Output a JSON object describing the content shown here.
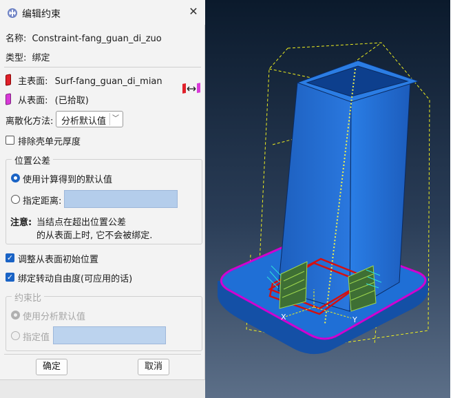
{
  "dialog": {
    "title": "编辑约束",
    "name_label": "名称:",
    "name_value": "Constraint-fang_guan_di_zuo",
    "type_label": "类型:",
    "type_value": "绑定",
    "master_label": "主表面:",
    "master_value": "Surf-fang_guan_di_mian",
    "slave_label": "从表面:",
    "slave_value": "(已拾取)",
    "discretization_label": "离散化方法:",
    "discretization_value": "分析默认值",
    "exclude_shell_label": "排除壳单元厚度",
    "exclude_shell_checked": false,
    "position_tolerance": {
      "title": "位置公差",
      "option_computed": "使用计算得到的默认值",
      "option_specify": "指定距离:",
      "specify_value": "",
      "note_label": "注意:",
      "note_line1": "当结点在超出位置公差",
      "note_line2": "的从表面上时, 它不会被绑定."
    },
    "adjust_slave_label": "调整从表面初始位置",
    "adjust_slave_checked": true,
    "tie_rotation_label": "绑定转动自由度(可应用的话)",
    "tie_rotation_checked": true,
    "constraint_ratio": {
      "title": "约束比",
      "option_default": "使用分析默认值",
      "option_specify": "指定值",
      "specify_value": ""
    },
    "ok_label": "确定",
    "cancel_label": "取消"
  },
  "viewport": {
    "triad_labels": [
      "X",
      "Y"
    ],
    "colors": {
      "background_top": "#0b1a2c",
      "background_bottom": "#5c6f88",
      "part": "#1f6fd6",
      "master_outline": "#d000d0",
      "slave_outline": "#d01010",
      "bounding_box": "#f0f020"
    }
  }
}
